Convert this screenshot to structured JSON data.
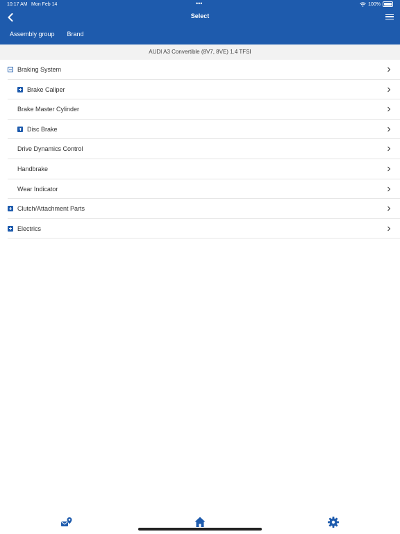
{
  "status_bar": {
    "time": "10:17 AM",
    "date": "Mon Feb 14",
    "dots": "•••",
    "battery": "100%"
  },
  "nav": {
    "title": "Select",
    "back_icon": "chevron-left-icon",
    "menu_icon": "hamburger-menu-icon"
  },
  "tabs": [
    {
      "label": "Assembly group"
    },
    {
      "label": "Brand"
    }
  ],
  "vehicle": {
    "name": "AUDI A3 Convertible (8V7, 8VE) 1.4 TFSI"
  },
  "list": [
    {
      "label": "Braking System",
      "toggle": "minus"
    },
    {
      "label": "Brake Caliper",
      "toggle": "plus"
    },
    {
      "label": "Brake Master Cylinder",
      "toggle": "none"
    },
    {
      "label": "Disc Brake",
      "toggle": "plus"
    },
    {
      "label": "Drive Dynamics Control",
      "toggle": "none"
    },
    {
      "label": "Handbrake",
      "toggle": "none"
    },
    {
      "label": "Wear Indicator",
      "toggle": "none"
    },
    {
      "label": "Clutch/Attachment Parts",
      "toggle": "plus"
    },
    {
      "label": "Electrics",
      "toggle": "plus"
    }
  ],
  "bottom_bar": {
    "icons": [
      "location-mail-icon",
      "home-icon",
      "gear-icon"
    ]
  },
  "colors": {
    "brand": "#1e5bad",
    "text": "#333333",
    "divider": "#e6e6e6"
  }
}
